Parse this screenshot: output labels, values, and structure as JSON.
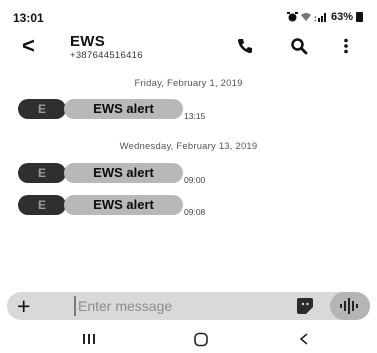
{
  "status_bar": {
    "time": "13:01",
    "battery": "63%"
  },
  "header": {
    "contact_name": "EWS",
    "contact_number": "+387644516416"
  },
  "conversation": {
    "groups": [
      {
        "date": "Friday, February 1, 2019",
        "messages": [
          {
            "avatar": "E",
            "text": "EWS alert",
            "time": "13:15"
          }
        ]
      },
      {
        "date": "Wednesday, February 13, 2019",
        "messages": [
          {
            "avatar": "E",
            "text": "EWS alert",
            "time": "09:00"
          },
          {
            "avatar": "E",
            "text": "EWS alert",
            "time": "09:08"
          }
        ]
      }
    ]
  },
  "composer": {
    "placeholder": "Enter message"
  },
  "icons": {
    "back": "back-arrow-icon",
    "call": "phone-icon",
    "search": "search-icon",
    "more": "more-vertical-icon",
    "attach": "plus-icon",
    "sticker": "sticker-icon",
    "voice": "voice-waveform-icon",
    "nav_recents": "recents-icon",
    "nav_home": "home-icon",
    "nav_back": "nav-back-icon"
  }
}
